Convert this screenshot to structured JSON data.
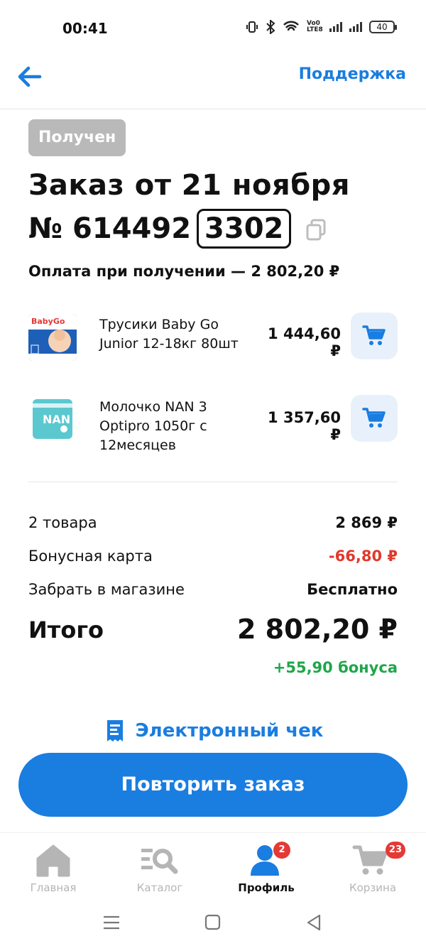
{
  "status_bar": {
    "time": "00:41",
    "battery": "40",
    "network": "Vo0 LTE8"
  },
  "header": {
    "back_icon": "arrow-left-icon",
    "support_label": "Поддержка"
  },
  "order": {
    "status": "Получен",
    "title": "Заказ от 21 ноября",
    "number_prefix": "№ 614492",
    "number_highlight": "3302",
    "payment": "Оплата при получении — 2 802,20 ₽"
  },
  "items": [
    {
      "name": "Трусики Baby Go Junior 12-18кг 80шт",
      "price": "1 444,60 ₽",
      "thumb_icon": "babygo-diapers-image",
      "cart_icon": "cart-icon"
    },
    {
      "name": "Молочко NAN 3 Optipro 1050г с 12месяцев",
      "price": "1 357,60 ₽",
      "thumb_icon": "nan-formula-image",
      "cart_icon": "cart-icon"
    }
  ],
  "summary": {
    "goods_label": "2 товара",
    "goods_value": "2 869 ₽",
    "bonus_card_label": "Бонусная карта",
    "bonus_card_value": "-66,80 ₽",
    "pickup_label": "Забрать в магазине",
    "pickup_value": "Бесплатно",
    "total_label": "Итого",
    "total_value": "2 802,20 ₽",
    "bonus_earned": "+55,90 бонуса"
  },
  "receipt": {
    "label": "Электронный чек",
    "icon": "receipt-icon"
  },
  "repeat_button": "Повторить заказ",
  "bottom_nav": {
    "items": [
      {
        "label": "Главная",
        "icon": "home-icon"
      },
      {
        "label": "Каталог",
        "icon": "catalog-search-icon"
      },
      {
        "label": "Профиль",
        "icon": "profile-icon",
        "badge": "2"
      },
      {
        "label": "Корзина",
        "icon": "cart-icon",
        "badge": "23"
      }
    ]
  },
  "colors": {
    "accent": "#1a7de0",
    "negative": "#e1392b",
    "positive": "#1fa64a",
    "chip": "#b9b9b9"
  }
}
